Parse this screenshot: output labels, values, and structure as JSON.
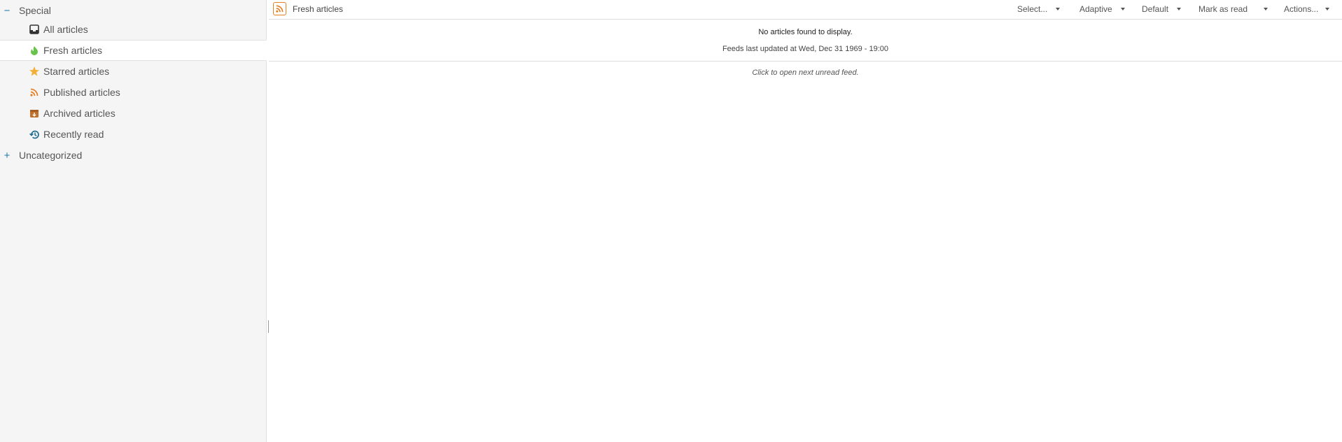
{
  "sidebar": {
    "special": {
      "toggle": "−",
      "label": "Special"
    },
    "items": [
      {
        "label": "All articles",
        "icon": "inbox-icon",
        "color": "#333333"
      },
      {
        "label": "Fresh articles",
        "icon": "fresh-icon",
        "color": "#69c24b",
        "selected": true
      },
      {
        "label": "Starred articles",
        "icon": "star-icon",
        "color": "#f2b03a"
      },
      {
        "label": "Published articles",
        "icon": "rss-icon",
        "color": "#e67e22"
      },
      {
        "label": "Archived articles",
        "icon": "archive-icon",
        "color": "#c0722b"
      },
      {
        "label": "Recently read",
        "icon": "history-icon",
        "color": "#1f6d95"
      }
    ],
    "uncategorized": {
      "toggle": "+",
      "label": "Uncategorized"
    }
  },
  "toolbar": {
    "feed_title": "Fresh articles",
    "select_label": "Select...",
    "view_label": "Adaptive",
    "order_label": "Default",
    "mark_read_label": "Mark as read",
    "actions_label": "Actions..."
  },
  "content": {
    "empty_message": "No articles found to display.",
    "updated_message": "Feeds last updated at Wed, Dec 31 1969 - 19:00",
    "next_unread": "Click to open next unread feed."
  }
}
